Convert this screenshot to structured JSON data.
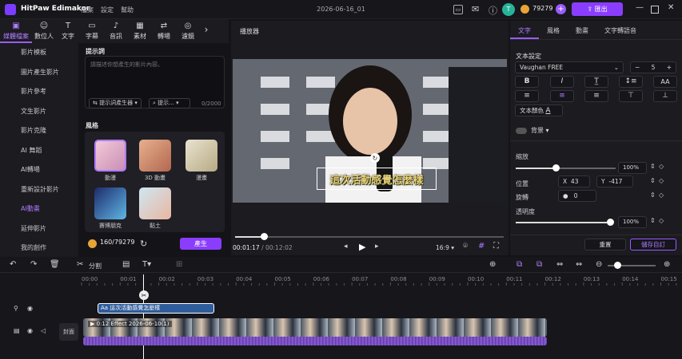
{
  "app": {
    "name": "HitPaw Edimakor",
    "menu": [
      "檔案",
      "設定",
      "幫助"
    ],
    "project_title": "2026-06-16_01",
    "credits": "79279",
    "export_label": "匯出",
    "avatar_letter": "T"
  },
  "tabs": [
    {
      "icon": "media-icon",
      "glyph": "▣",
      "label": "媒體檔案"
    },
    {
      "icon": "avatar-icon",
      "glyph": "☺",
      "label": "數位人"
    },
    {
      "icon": "text-icon",
      "glyph": "T",
      "label": "文字"
    },
    {
      "icon": "subtitle-icon",
      "glyph": "▭",
      "label": "字幕"
    },
    {
      "icon": "audio-icon",
      "glyph": "♪",
      "label": "音訊"
    },
    {
      "icon": "material-icon",
      "glyph": "▦",
      "label": "素材"
    },
    {
      "icon": "transition-icon",
      "glyph": "⇄",
      "label": "轉場"
    },
    {
      "icon": "filter-icon",
      "glyph": "◎",
      "label": "濾鏡"
    }
  ],
  "sidebar": [
    "影片模板",
    "圖片產生影片",
    "影片參考",
    "文生影片",
    "影片克隆",
    "AI 舞蹈",
    "AI轉場",
    "重新設計影片",
    "AI動畫",
    "延伸影片",
    "我的創作"
  ],
  "prompt": {
    "label": "提示詞",
    "placeholder": "請描述你想產生的影片內容。",
    "generator": "提示詞產生器",
    "hint": "提示...",
    "count": "0/2000"
  },
  "style": {
    "label": "風格",
    "items": [
      "動漫",
      "3D 動畫",
      "漫畫",
      "賽博朋克",
      "黏土"
    ]
  },
  "gen": {
    "credits": "160/79279",
    "button": "產生"
  },
  "player": {
    "title": "播放器",
    "current": "00:01:17",
    "total": "/ 00:12:02",
    "ratio": "16:9",
    "subtitle": "這次活動感覺怎麼樣",
    "progress": 0.107
  },
  "right": {
    "tabs": [
      "文字",
      "風格",
      "動畫",
      "文字轉語音"
    ],
    "text_settings": "文本設定",
    "font": "Vaughan FREE",
    "font_size": "5",
    "text_color_label": "文本顏色",
    "bg_label": "背景",
    "scale_label": "縮放",
    "scale": "100%",
    "scale_value": 0.4,
    "pos_label": "位置",
    "x_label": "X",
    "x": "43",
    "y_label": "Y",
    "y": "-417",
    "rot_label": "旋轉",
    "rot": "0",
    "opacity_label": "透明度",
    "opacity": "100%",
    "opacity_value": 1.0,
    "reset": "重置",
    "save": "儲存自訂"
  },
  "timeline": {
    "split": "分割",
    "ticks": [
      "00:00",
      "00:01",
      "00:02",
      "00:03",
      "00:04",
      "00:05",
      "00:06",
      "00:07",
      "00:08",
      "00:09",
      "00:10",
      "00:11",
      "00:12",
      "00:13",
      "00:14",
      "00:15"
    ],
    "text_clip": "Aa 這次活動感覺怎麼樣",
    "video_clip": "0:12 Effect 2026-06-10(1)",
    "cover": "封面"
  }
}
